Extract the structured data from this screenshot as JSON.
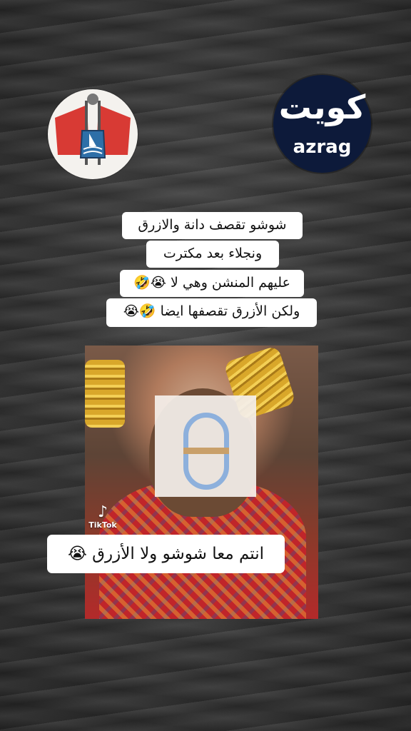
{
  "logos": {
    "crest_icon": "kuwait-crest-flags",
    "azrag_ar": "كويت",
    "azrag_en": "azrag",
    "azrag_color": "#0d1a3a"
  },
  "caption": {
    "lines": [
      "شوشو تقصف دانة والازرق",
      "ونجلاء بعد مكترت",
      "عليهم المنشن وهي لا 😭🤣",
      "ولكن الأزرق تقصفها ايضا 🤣😭"
    ]
  },
  "watermark": {
    "icon": "tiktok-note-icon",
    "glyph": "♪",
    "label": "TikTok"
  },
  "question": "انتم معا شوشو ولا الأزرق 😭"
}
